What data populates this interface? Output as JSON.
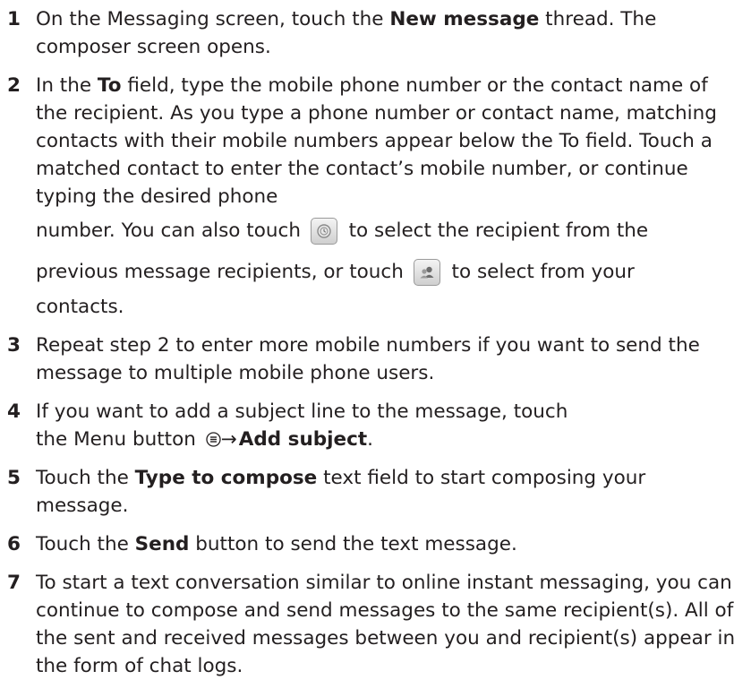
{
  "steps": [
    {
      "num": "1",
      "parts": [
        {
          "t": "On the Messaging screen, touch the "
        },
        {
          "b": "New message"
        },
        {
          "t": " thread. The composer screen opens."
        }
      ]
    },
    {
      "num": "2",
      "line1": "In the ",
      "line1_bold": "To",
      "line1_rest": " field, type the mobile phone number or the contact name of the recipient. As you type a phone number or contact name, matching contacts with their mobile numbers appear below the To field. Touch a matched contact to enter the contact’s mobile number, or continue typing the desired phone",
      "line2_before": "number. You can also touch ",
      "line2_after": " to select the recipient from the",
      "line3_before": "previous message recipients, or touch ",
      "line3_after": " to select from your",
      "line4": "contacts."
    },
    {
      "num": "3",
      "parts": [
        {
          "t": "Repeat step 2 to enter more mobile numbers if you want to send the message to multiple mobile phone users."
        }
      ]
    },
    {
      "num": "4",
      "line1": "If you want to add a subject line to the message, touch",
      "line2_before": "the Menu button ",
      "arrow": "→",
      "line2_bold": "Add subject",
      "line2_after": "."
    },
    {
      "num": "5",
      "parts": [
        {
          "t": "Touch the "
        },
        {
          "b": "Type to compose"
        },
        {
          "t": " text field to start composing your message."
        }
      ]
    },
    {
      "num": "6",
      "parts": [
        {
          "t": "Touch the "
        },
        {
          "b": "Send"
        },
        {
          "t": " button to send the text message."
        }
      ]
    },
    {
      "num": "7",
      "parts": [
        {
          "t": "To start a text conversation similar to online instant messaging, you can continue to compose and send messages to the same recipient(s). All of the sent and received messages between you and recipient(s) appear in the form of chat logs."
        }
      ]
    }
  ],
  "icons": {
    "recent_recipients": "recent-recipients-icon",
    "contacts": "contacts-icon",
    "menu": "menu-icon"
  }
}
